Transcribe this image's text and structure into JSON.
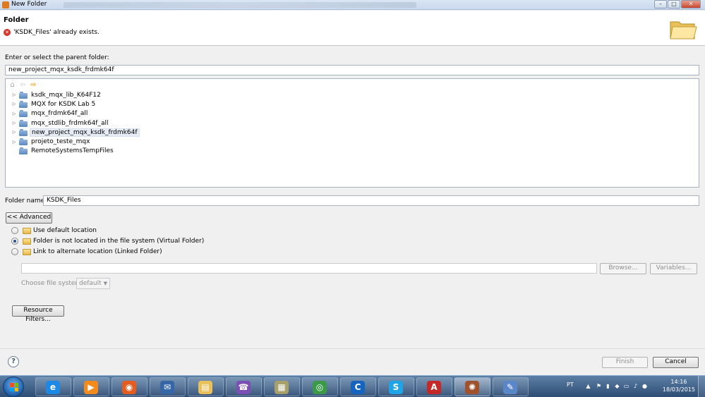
{
  "window": {
    "title": "New Folder",
    "controls": {
      "minimize": "–",
      "maximize": "□",
      "close": "✕"
    }
  },
  "header": {
    "heading": "Folder",
    "error_message": "'KSDK_Files' already exists.",
    "error_icon_glyph": "✕"
  },
  "parent": {
    "label": "Enter or select the parent folder:",
    "value": "new_project_mqx_ksdk_frdmk64f"
  },
  "tree": {
    "toolbar": {
      "home": "⌂",
      "back": "⇦",
      "forward": "⇨"
    },
    "items": [
      {
        "label": "ksdk_mqx_lib_K64F12",
        "expandable": true
      },
      {
        "label": "MQX for KSDK Lab 5",
        "expandable": true
      },
      {
        "label": "mqx_frdmk64f_all",
        "expandable": true
      },
      {
        "label": "mqx_stdlib_frdmk64f_all",
        "expandable": true
      },
      {
        "label": "new_project_mqx_ksdk_frdmk64f",
        "expandable": true,
        "selected": true
      },
      {
        "label": "projeto_teste_mqx",
        "expandable": true
      },
      {
        "label": "RemoteSystemsTempFiles",
        "expandable": false
      }
    ],
    "expander_glyph": "▷"
  },
  "folder_name": {
    "label": "Folder name:",
    "value": "KSDK_Files"
  },
  "advanced_button": "<< Advanced",
  "location_options": [
    {
      "label": "Use default location",
      "checked": false
    },
    {
      "label": "Folder is not located in the file system (Virtual Folder)",
      "checked": true
    },
    {
      "label": "Link to alternate location (Linked Folder)",
      "checked": false
    }
  ],
  "linked": {
    "path_value": "",
    "browse_label": "Browse...",
    "variables_label": "Variables...",
    "file_system_label": "Choose file system:",
    "file_system_value": "default",
    "select_arrow": "▼"
  },
  "resource_filters_label": "Resource Filters...",
  "footer": {
    "help_glyph": "?",
    "finish_label": "Finish",
    "cancel_label": "Cancel"
  },
  "taskbar": {
    "items": [
      {
        "name": "internet-explorer-icon",
        "glyph": "e",
        "color": "#1e88e5"
      },
      {
        "name": "media-player-icon",
        "glyph": "▶",
        "color": "#f28b1b"
      },
      {
        "name": "firefox-icon",
        "glyph": "◉",
        "color": "#e65c1f"
      },
      {
        "name": "thunderbird-icon",
        "glyph": "✉",
        "color": "#3567a8"
      },
      {
        "name": "file-explorer-icon",
        "glyph": "▤",
        "color": "#e8c15a"
      },
      {
        "name": "viber-icon",
        "glyph": "☎",
        "color": "#7b4fb5"
      },
      {
        "name": "archive-icon",
        "glyph": "▦",
        "color": "#a7a06a"
      },
      {
        "name": "chrome-icon",
        "glyph": "◎",
        "color": "#3a9a48"
      },
      {
        "name": "ccleaner-icon",
        "glyph": "C",
        "color": "#1565c0"
      },
      {
        "name": "skype-icon",
        "glyph": "S",
        "color": "#1fa4e8"
      },
      {
        "name": "acrobat-icon",
        "glyph": "A",
        "color": "#c62828"
      },
      {
        "name": "kinetis-icon",
        "glyph": "✺",
        "color": "#a0522d"
      },
      {
        "name": "paint-icon",
        "glyph": "✎",
        "color": "#5a87c8"
      }
    ],
    "active_index": 11,
    "language": "PT",
    "tray_up": "▲",
    "time": "14:16",
    "date": "18/03/2015"
  }
}
